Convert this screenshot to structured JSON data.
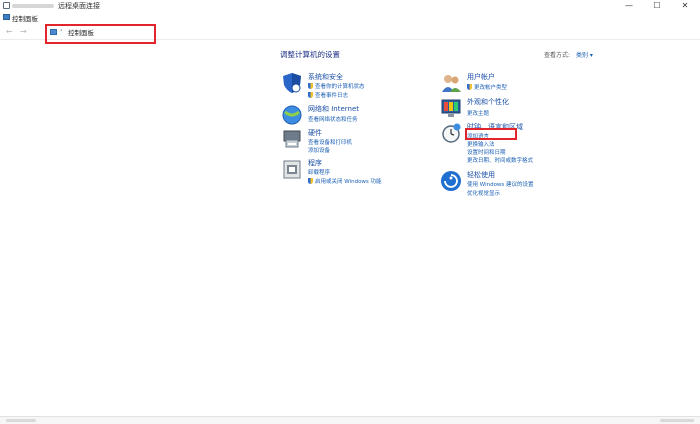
{
  "remote_window": {
    "title": "远程桌面连接",
    "minimize": "—",
    "maximize": "☐",
    "close": "✕"
  },
  "window": {
    "title": "控制面板"
  },
  "nav": {
    "back": "←",
    "forward": "→",
    "breadcrumb_sep": "›",
    "breadcrumb": "控制面板"
  },
  "heading": "调整计算机的设置",
  "view_by": {
    "label": "查看方式:",
    "value": "类别 ▾"
  },
  "left_categories": [
    {
      "icon": "system-security-icon",
      "title": "系统和安全",
      "links": [
        "查看你的计算机状态",
        "查看事件日志"
      ]
    },
    {
      "icon": "network-internet-icon",
      "title": "网络和 Internet",
      "links": [
        "查看网络状态和任务"
      ]
    },
    {
      "icon": "hardware-sound-icon",
      "title": "硬件",
      "links": [
        "查看设备和打印机",
        "添加设备"
      ]
    },
    {
      "icon": "programs-icon",
      "title": "程序",
      "links": [
        "卸载程序",
        "启用或关闭 Windows 功能"
      ]
    }
  ],
  "right_categories": [
    {
      "icon": "user-accounts-icon",
      "title": "用户帐户",
      "links": [
        "更改帐户类型"
      ]
    },
    {
      "icon": "appearance-icon",
      "title": "外观和个性化",
      "links": [
        "更改主题"
      ]
    },
    {
      "icon": "clock-region-icon",
      "title": "时钟、语言和区域",
      "links": [
        "添加语言",
        "更换输入法",
        "设置时间和日期",
        "更改日期、时间或数字格式"
      ]
    },
    {
      "icon": "ease-of-access-icon",
      "title": "轻松使用",
      "links": [
        "使用 Windows 建议的设置",
        "优化视觉显示"
      ]
    }
  ],
  "colors": {
    "highlight": "#e1252b",
    "link": "#1a5fb4",
    "heading": "#1e3287"
  }
}
